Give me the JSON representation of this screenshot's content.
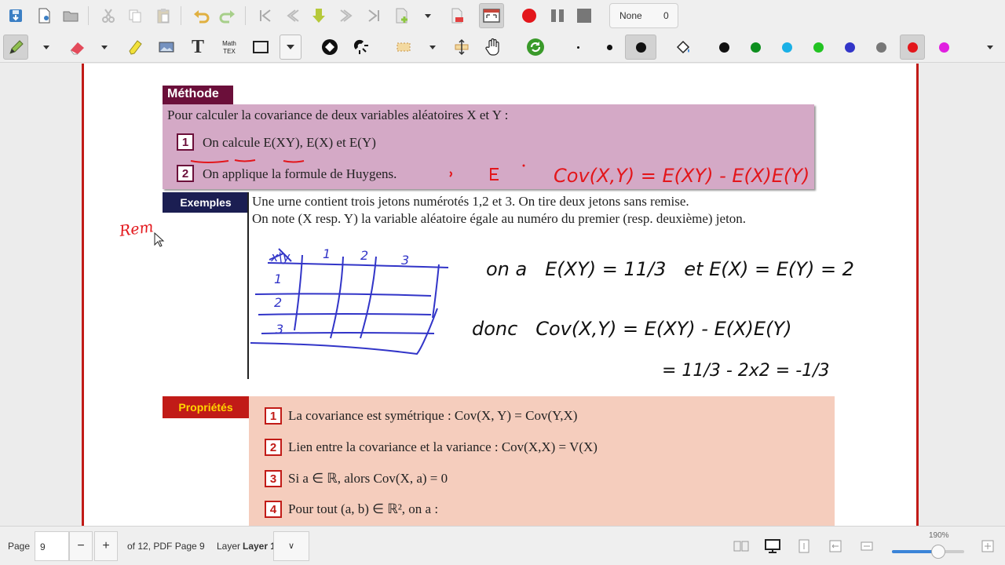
{
  "toolbar": {
    "recording": {
      "mode": "None",
      "count": "0"
    },
    "pen_colors": [
      "#111111",
      "#0d8f1e",
      "#1ab0e6",
      "#22c322",
      "#3235c8",
      "#777777",
      "#e3161b",
      "#e020e0"
    ],
    "dot_sizes": [
      "small",
      "medium",
      "large"
    ]
  },
  "document": {
    "methode": {
      "tab": "Méthode",
      "intro": "Pour calculer la covariance de deux variables aléatoires X et Y :",
      "steps": [
        {
          "num": "1",
          "text": "On calcule E(XY), E(X) et E(Y)"
        },
        {
          "num": "2",
          "text": "On applique la formule de Huygens."
        }
      ]
    },
    "exemples": {
      "tab": "Exemples",
      "line1": "Une urne contient trois jetons numérotés 1,2 et 3. On tire deux jetons sans remise.",
      "line2": "On note (X resp. Y) la variable aléatoire égale au numéro du premier (resp. deuxième) jeton."
    },
    "proprietes": {
      "tab": "Propriétés",
      "items": [
        {
          "num": "1",
          "text": "La covariance est symétrique : Cov(X, Y) = Cov(Y,X)"
        },
        {
          "num": "2",
          "text": "Lien entre la covariance et la variance : Cov(X,X) = V(X)"
        },
        {
          "num": "3",
          "text": "Si a ∈ ℝ, alors Cov(X, a) = 0"
        },
        {
          "num": "4",
          "text": "Pour tout (a, b) ∈ ℝ², on a :"
        }
      ]
    },
    "handwriting": {
      "huygens": "Cov(X,Y) = E(XY) - E(X)E(Y)",
      "margin_note": "Rem",
      "table_headers": [
        "x\\y",
        "1",
        "2",
        "3"
      ],
      "table_rows": [
        "1",
        "2",
        "3"
      ],
      "line_ona": "on a   E(XY) = 11/3   et E(X) = E(Y) = 2",
      "line_donc": "donc   Cov(X,Y) = E(XY) - E(X)E(Y)",
      "line_result": "= 11/3 - 2x2 = -1/3"
    }
  },
  "status": {
    "page_label": "Page",
    "page_value": "9",
    "page_info": "of 12, PDF Page 9",
    "layer_label": "Layer",
    "layer_value": "Layer 1",
    "zoom": "190%",
    "zoom_fraction": 0.6
  }
}
